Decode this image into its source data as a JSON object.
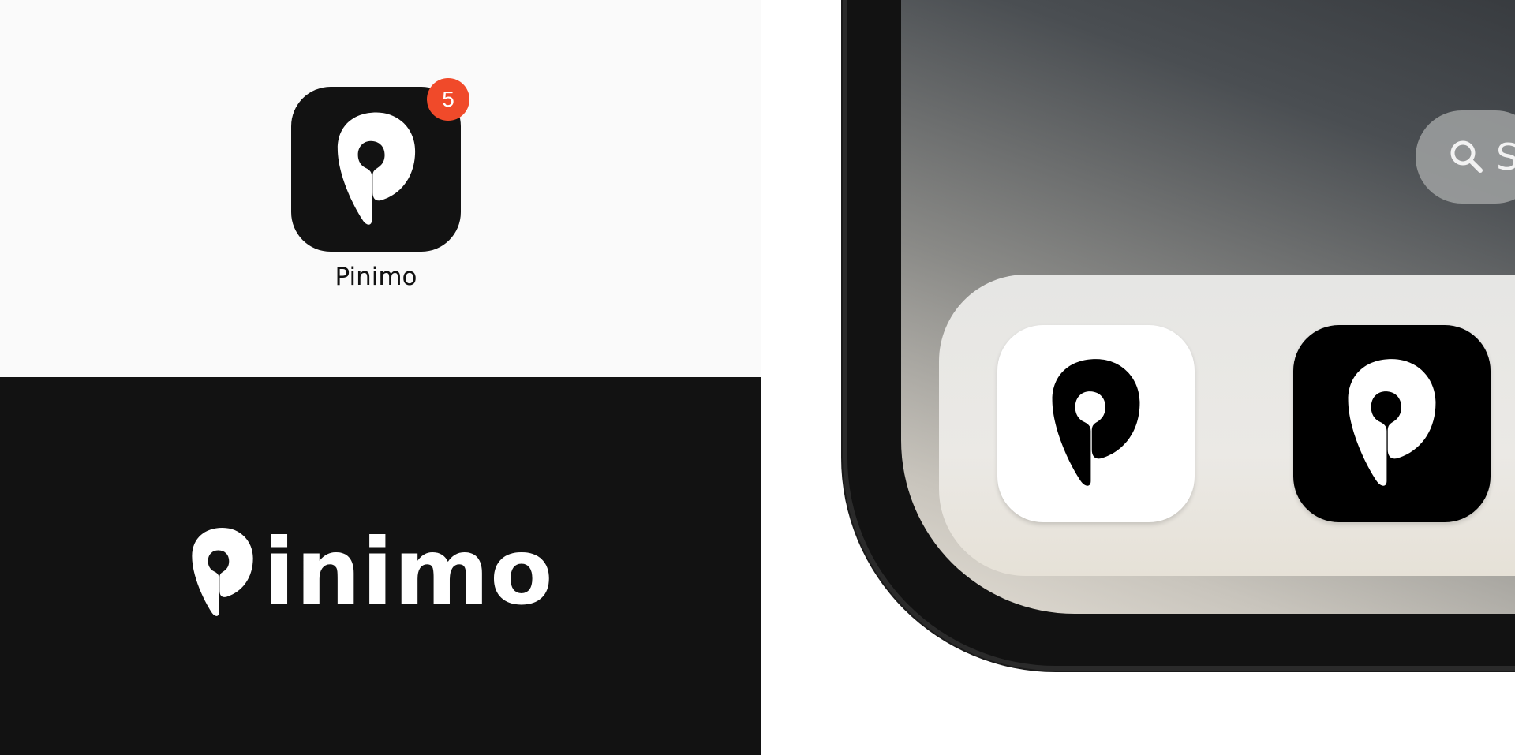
{
  "app": {
    "name": "Pinimo",
    "badge_count": "5"
  },
  "wordmark": {
    "text": "inimo"
  },
  "home_screen": {
    "search_text": "S"
  },
  "colors": {
    "badge": "#f04a2a",
    "icon_dark": "#121212",
    "icon_light": "#ffffff",
    "dark_panel": "#121212",
    "light_panel": "#fafafa"
  },
  "icons": {
    "logo": "pin-logo-icon",
    "search": "search-icon"
  }
}
